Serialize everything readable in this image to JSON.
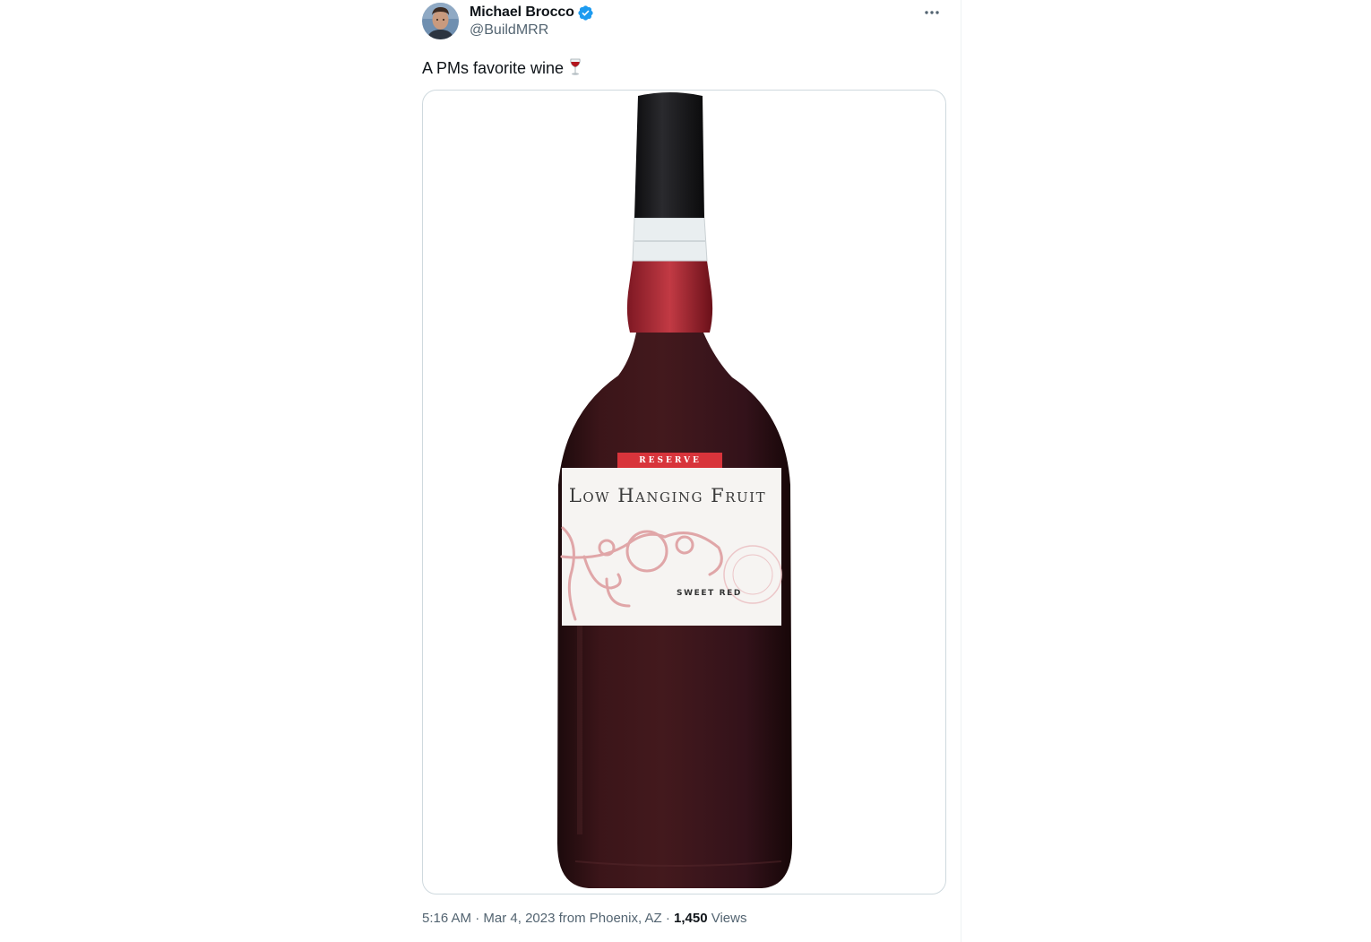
{
  "tweet": {
    "author": {
      "display_name": "Michael Brocco",
      "handle": "@BuildMRR",
      "avatar_icon": "avatar-photo",
      "verified": true,
      "verified_color": "#1d9bf0"
    },
    "more_icon": "more-horizontal-icon",
    "text": "A PMs favorite wine",
    "text_emoji": "wine-glass",
    "media": {
      "label_reserve": "RESERVE",
      "label_brand": "Low Hanging Fruit",
      "label_brand_mark": "",
      "label_variety": "SWEET RED"
    },
    "meta": {
      "time": "5:16 AM",
      "separator": "·",
      "date": "Mar 4, 2023",
      "location": "from Phoenix, AZ",
      "views_count": "1,450",
      "views_label": "Views"
    }
  },
  "colors": {
    "text_primary": "#0f1419",
    "text_secondary": "#536471",
    "border": "#cfd9de",
    "wine": "#3a1418",
    "label_red": "#d8343b"
  }
}
